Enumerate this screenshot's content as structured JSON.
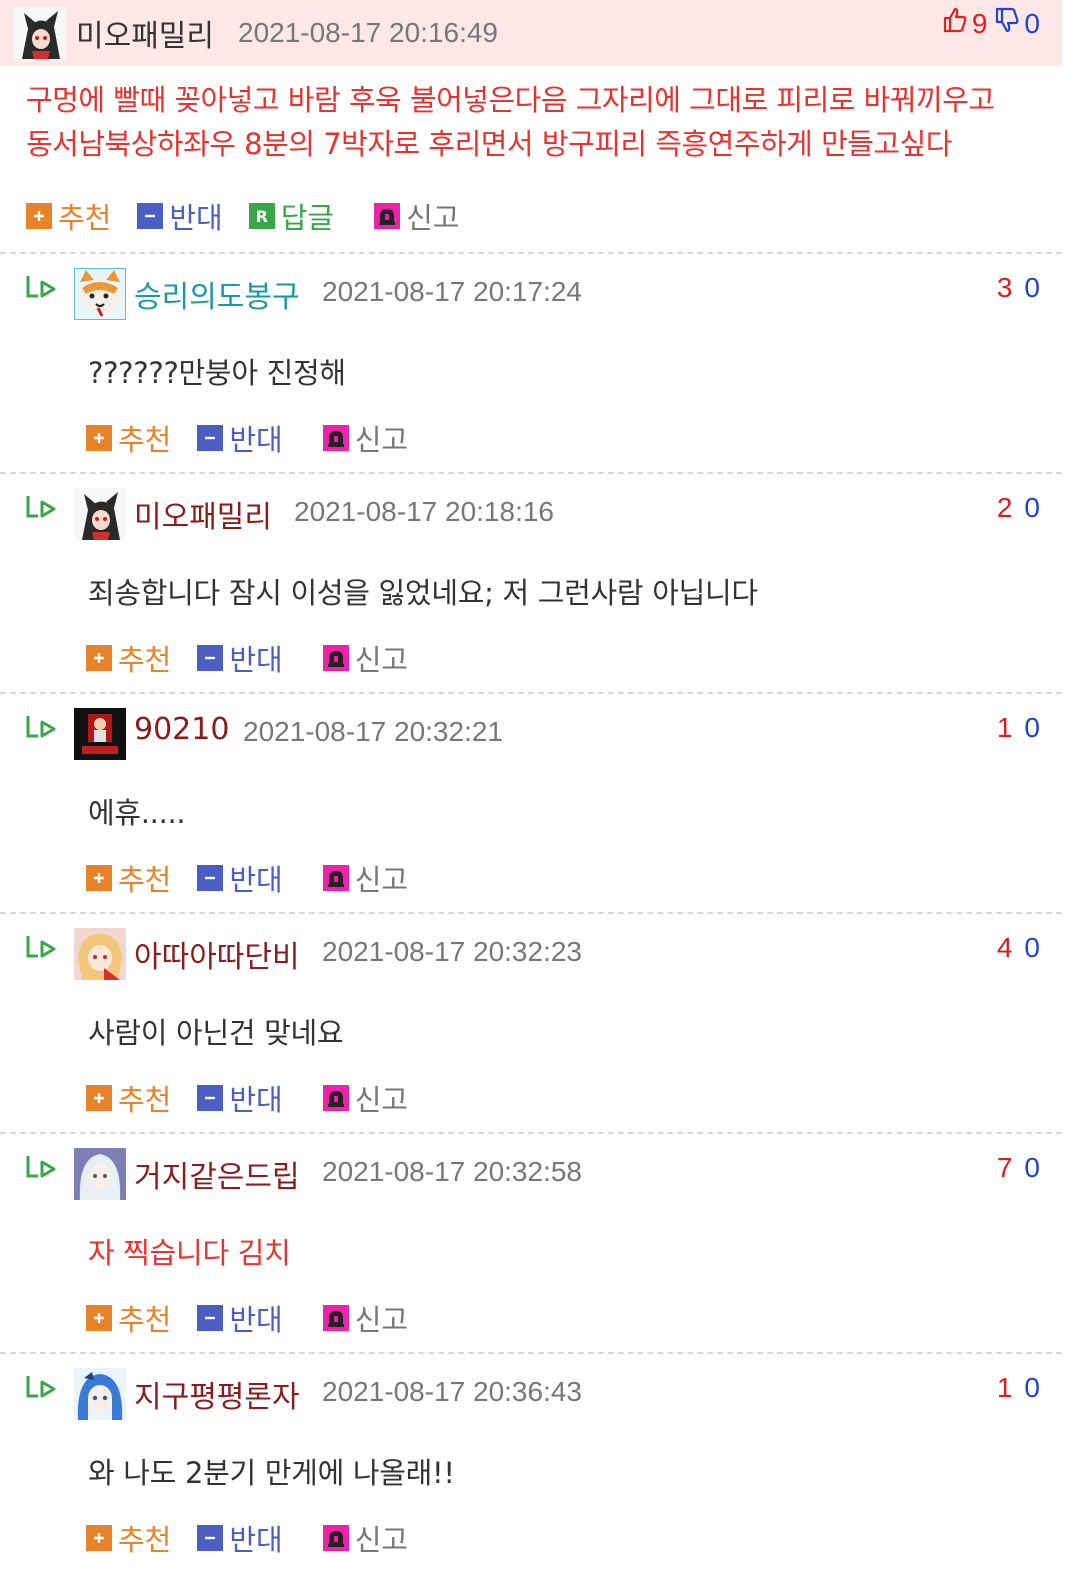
{
  "main": {
    "nickname": "미오패밀리",
    "nickname_color": "#333333",
    "timestamp": "2021-08-17 20:16:49",
    "up_count": "9",
    "down_count": "0",
    "body_lines": [
      "구멍에 빨때 꽂아넣고 바람 후욱 불어넣은다음 그자리에 그대로 피리로 바꿔끼우고",
      "동서남북상하좌우 8분의 7박자로 후리면서 방구피리 즉흥연주하게 만들고싶다"
    ],
    "actions": {
      "up": "추천",
      "down": "반대",
      "reply": "답글",
      "report": "신고"
    }
  },
  "replies": [
    {
      "nickname": "승리의도봉구",
      "nick_color": "#1a9aa0",
      "timestamp": "2021-08-17 20:17:24",
      "up": "3",
      "down": "0",
      "body": "??????만붕아 진정해",
      "body_color": "#333333",
      "avatar": "cat-avatar"
    },
    {
      "nickname": "미오패밀리",
      "nick_color": "#8a1c1c",
      "timestamp": "2021-08-17 20:18:16",
      "up": "2",
      "down": "0",
      "body": "죄송합니다 잠시 이성을 잃었네요; 저 그런사람 아닙니다",
      "body_color": "#333333",
      "avatar": "wolf-girl-avatar"
    },
    {
      "nickname": "90210",
      "nick_color": "#8a1c1c",
      "timestamp": "2021-08-17 20:32:21",
      "up": "1",
      "down": "0",
      "body": "에휴.....",
      "body_color": "#333333",
      "avatar": "dark-poster-avatar"
    },
    {
      "nickname": "아따아따단비",
      "nick_color": "#8a1c1c",
      "timestamp": "2021-08-17 20:32:23",
      "up": "4",
      "down": "0",
      "body": "사람이 아닌건 맞네요",
      "body_color": "#333333",
      "avatar": "blonde-girl-avatar"
    },
    {
      "nickname": "거지같은드립",
      "nick_color": "#8a1c1c",
      "timestamp": "2021-08-17 20:32:58",
      "up": "7",
      "down": "0",
      "body": "자 찍습니다 김치",
      "body_color": "#e8322f",
      "avatar": "white-hair-avatar"
    },
    {
      "nickname": "지구평평론자",
      "nick_color": "#8a1c1c",
      "timestamp": "2021-08-17 20:36:43",
      "up": "1",
      "down": "0",
      "body": "와 나도 2분기 만게에 나올래!!",
      "body_color": "#333333",
      "avatar": "blue-hair-avatar"
    }
  ],
  "reply_actions": {
    "up": "추천",
    "down": "반대",
    "report": "신고"
  },
  "colors": {
    "up": "#e8832a",
    "down": "#4a5ec4",
    "reply": "#3aa64a",
    "report_icon": "#ee22aa",
    "header_bg": "#fde7e7"
  }
}
